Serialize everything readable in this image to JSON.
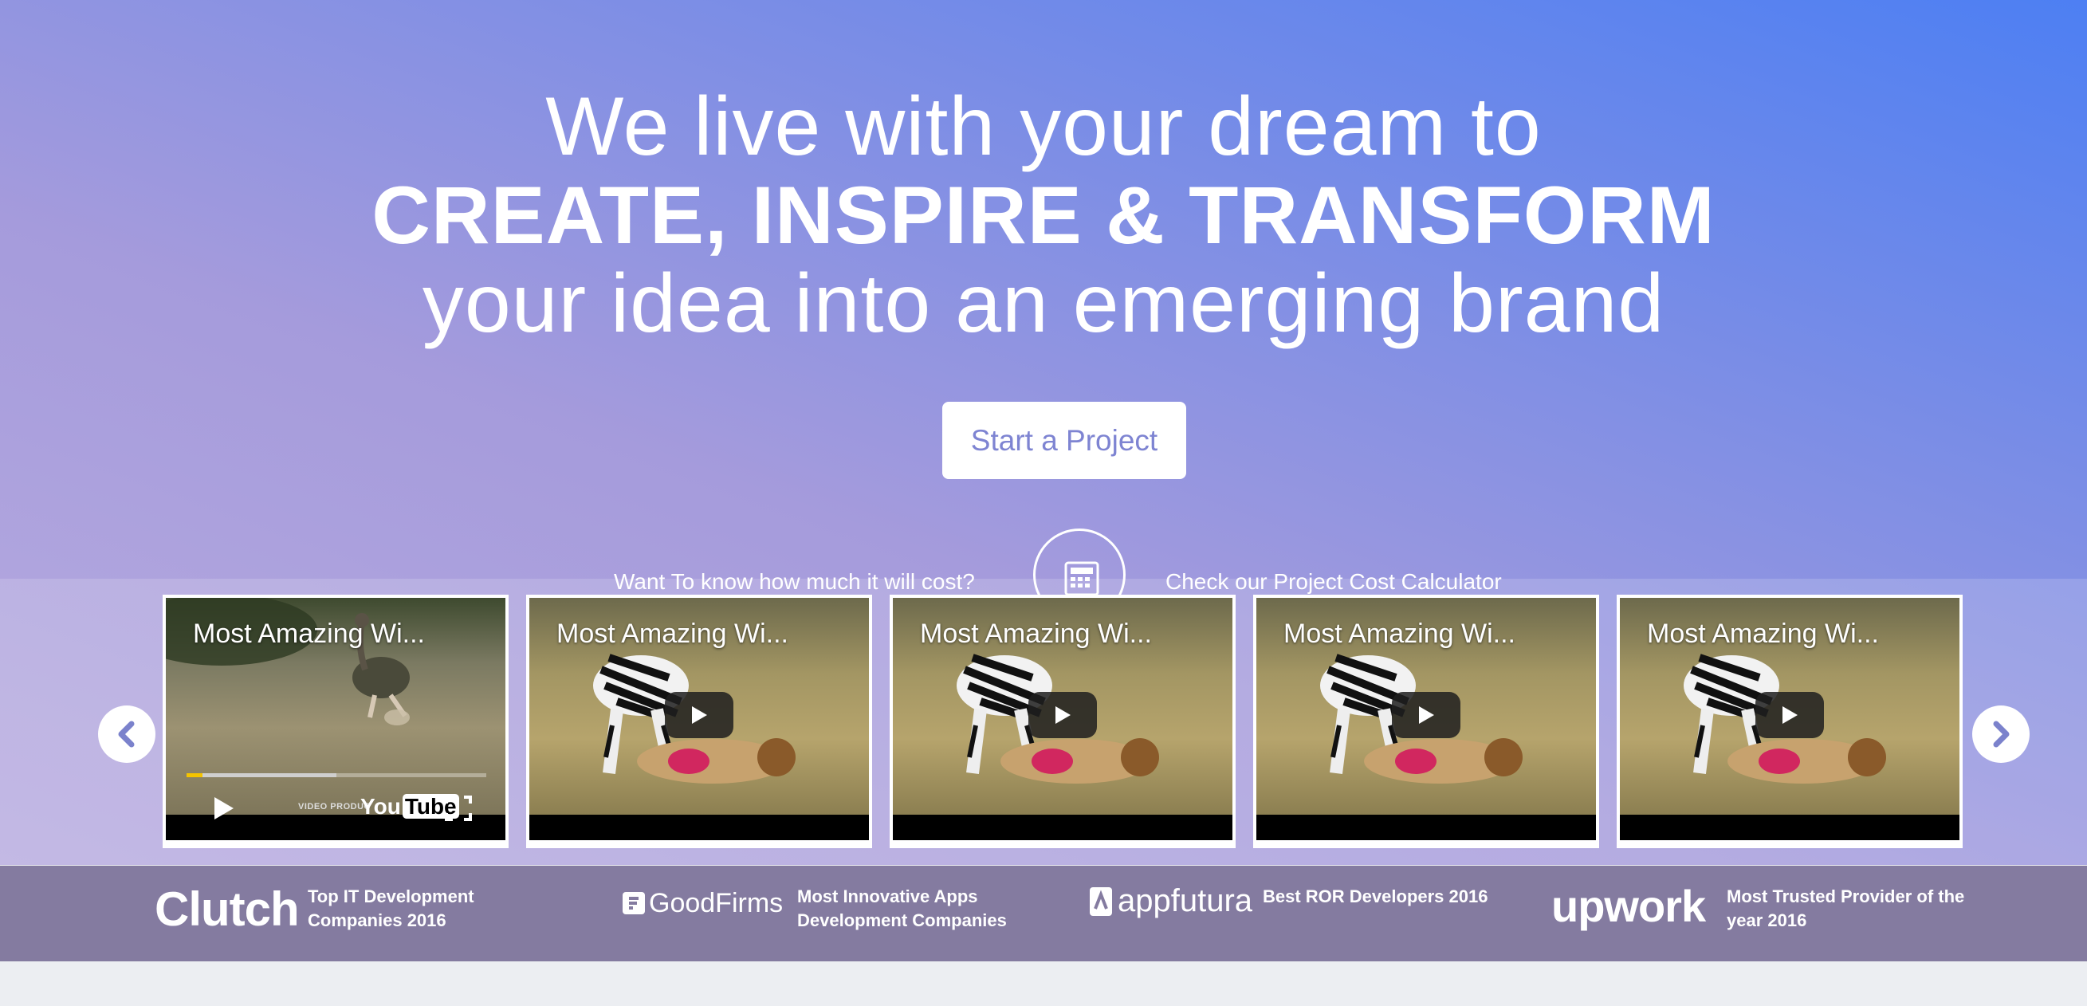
{
  "headline": {
    "line1": "We live with your dream to",
    "line2": "CREATE, INSPIRE & TRANSFORM",
    "line3": "your idea into an emerging brand"
  },
  "cta": {
    "label": "Start a Project"
  },
  "calculator": {
    "left_text": "Want To know how much it will cost?",
    "right_text": "Check our Project Cost Calculator",
    "icon": "calculator-icon"
  },
  "carousel": {
    "prev_icon": "chevron-left-icon",
    "next_icon": "chevron-right-icon",
    "videos": [
      {
        "title": "Most Amazing Wi...",
        "state": "playing",
        "progress": 0.5,
        "control_label": "VIDEO PRODUC",
        "brand": "YouTube"
      },
      {
        "title": "Most Amazing Wi...",
        "state": "paused"
      },
      {
        "title": "Most Amazing Wi...",
        "state": "paused"
      },
      {
        "title": "Most Amazing Wi...",
        "state": "paused"
      },
      {
        "title": "Most Amazing Wi...",
        "state": "paused"
      }
    ]
  },
  "awards": [
    {
      "logo": "Clutch",
      "text_line1": "Top IT Development",
      "text_line2": "Companies 2016"
    },
    {
      "logo": "GoodFirms",
      "text_line1": "Most Innovative Apps",
      "text_line2": "Development Companies"
    },
    {
      "logo": "appfutura",
      "text_line1": "Best ROR Developers 2016",
      "text_line2": ""
    },
    {
      "logo": "upwork",
      "text_line1": "Most Trusted Provider of the",
      "text_line2": "year 2016"
    }
  ],
  "colors": {
    "gradient_top_right": "#4d7ff3",
    "gradient_bottom_left": "#b8acdf",
    "cta_text": "#7e84d2",
    "awards_bar": "#847ba0"
  }
}
